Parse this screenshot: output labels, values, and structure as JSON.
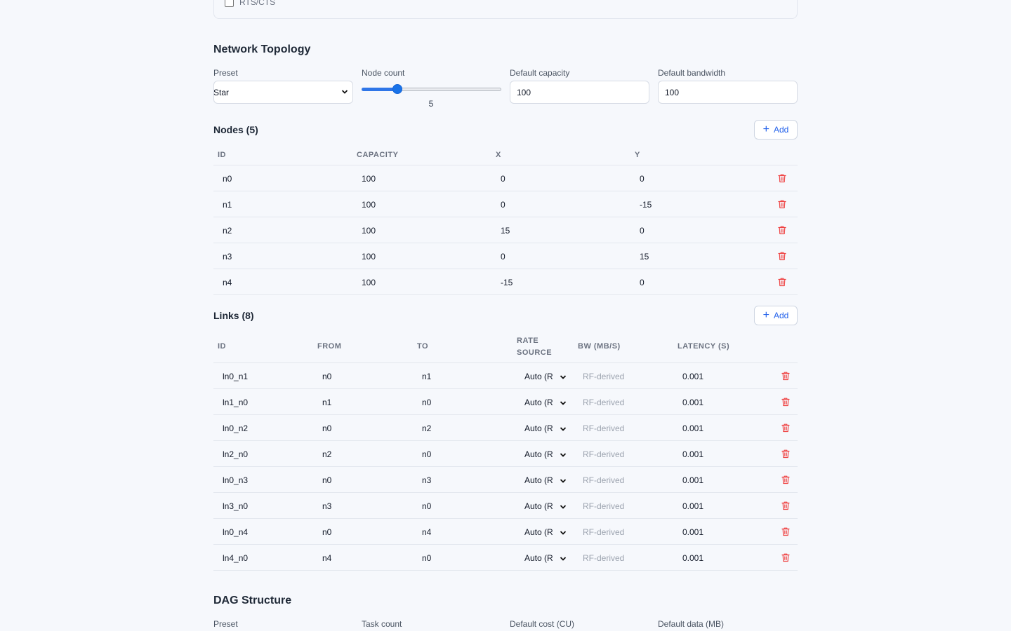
{
  "rts_cts": {
    "label": "RTS/CTS",
    "checked": false
  },
  "network_topology": {
    "title": "Network Topology",
    "preset": {
      "label": "Preset",
      "value": "Star"
    },
    "node_count": {
      "label": "Node count",
      "value": "5",
      "min": 2,
      "max": 20,
      "current": 5
    },
    "default_capacity": {
      "label": "Default capacity",
      "value": "100"
    },
    "default_bandwidth": {
      "label": "Default bandwidth",
      "value": "100"
    }
  },
  "nodes": {
    "title": "Nodes (5)",
    "add_label": "Add",
    "columns": [
      "ID",
      "CAPACITY",
      "X",
      "Y"
    ],
    "rows": [
      {
        "id": "n0",
        "capacity": "100",
        "x": "0",
        "y": "0"
      },
      {
        "id": "n1",
        "capacity": "100",
        "x": "0",
        "y": "-15"
      },
      {
        "id": "n2",
        "capacity": "100",
        "x": "15",
        "y": "0"
      },
      {
        "id": "n3",
        "capacity": "100",
        "x": "0",
        "y": "15"
      },
      {
        "id": "n4",
        "capacity": "100",
        "x": "-15",
        "y": "0"
      }
    ]
  },
  "links": {
    "title": "Links (8)",
    "add_label": "Add",
    "columns": {
      "id": "ID",
      "from": "FROM",
      "to": "TO",
      "rate_source_1": "RATE",
      "rate_source_2": "SOURCE",
      "bw": "BW (MB/S)",
      "latency": "LATENCY (S)"
    },
    "rows": [
      {
        "id": "ln0_n1",
        "from": "n0",
        "to": "n1",
        "rate_source": "Auto (R",
        "bw": "RF-derived",
        "latency": "0.001"
      },
      {
        "id": "ln1_n0",
        "from": "n1",
        "to": "n0",
        "rate_source": "Auto (R",
        "bw": "RF-derived",
        "latency": "0.001"
      },
      {
        "id": "ln0_n2",
        "from": "n0",
        "to": "n2",
        "rate_source": "Auto (R",
        "bw": "RF-derived",
        "latency": "0.001"
      },
      {
        "id": "ln2_n0",
        "from": "n2",
        "to": "n0",
        "rate_source": "Auto (R",
        "bw": "RF-derived",
        "latency": "0.001"
      },
      {
        "id": "ln0_n3",
        "from": "n0",
        "to": "n3",
        "rate_source": "Auto (R",
        "bw": "RF-derived",
        "latency": "0.001"
      },
      {
        "id": "ln3_n0",
        "from": "n3",
        "to": "n0",
        "rate_source": "Auto (R",
        "bw": "RF-derived",
        "latency": "0.001"
      },
      {
        "id": "ln0_n4",
        "from": "n0",
        "to": "n4",
        "rate_source": "Auto (R",
        "bw": "RF-derived",
        "latency": "0.001"
      },
      {
        "id": "ln4_n0",
        "from": "n4",
        "to": "n0",
        "rate_source": "Auto (R",
        "bw": "RF-derived",
        "latency": "0.001"
      }
    ]
  },
  "dag_structure": {
    "title": "DAG Structure",
    "preset_label": "Preset",
    "task_count_label": "Task count",
    "default_cost_label": "Default cost (CU)",
    "default_data_label": "Default data (MB)"
  },
  "colors": {
    "accent": "#2563eb",
    "danger": "#ef4444",
    "background": "#f6f8fc"
  }
}
